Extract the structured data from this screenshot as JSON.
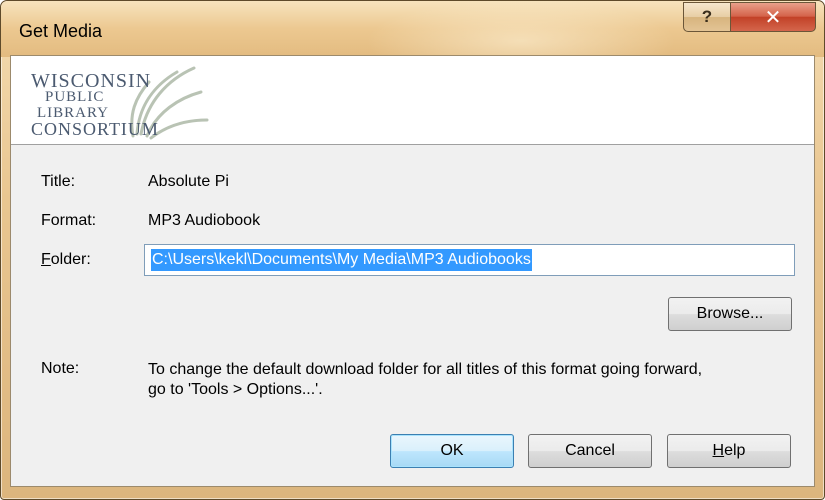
{
  "window": {
    "title": "Get Media",
    "help_glyph": "?",
    "close_glyph": "✕"
  },
  "banner": {
    "logo_lines": [
      "WISCONSIN",
      "PUBLIC",
      "LIBRARY",
      "CONSORTIUM"
    ]
  },
  "fields": {
    "title_label": "Title:",
    "title_value": "Absolute Pi",
    "format_label": "Format:",
    "format_value": "MP3 Audiobook",
    "folder_label_accel": "F",
    "folder_label_rest": "older:",
    "folder_value": "C:\\Users\\kekl\\Documents\\My Media\\MP3 Audiobooks"
  },
  "buttons": {
    "browse": "Browse...",
    "ok": "OK",
    "cancel": "Cancel",
    "help_accel": "H",
    "help_rest": "elp"
  },
  "note": {
    "label": "Note:",
    "line1": "To change the default download folder for all titles of this format going forward,",
    "line2": "go to 'Tools > Options...'."
  },
  "colors": {
    "title_bar": "#ecc890",
    "close_button": "#c24127",
    "selection": "#3399ff",
    "logo_ink": "#4b5a70"
  },
  "icons": {
    "help": "question-mark-icon",
    "close": "close-x-icon",
    "logo": "wisconsin-public-library-consortium-logo"
  }
}
